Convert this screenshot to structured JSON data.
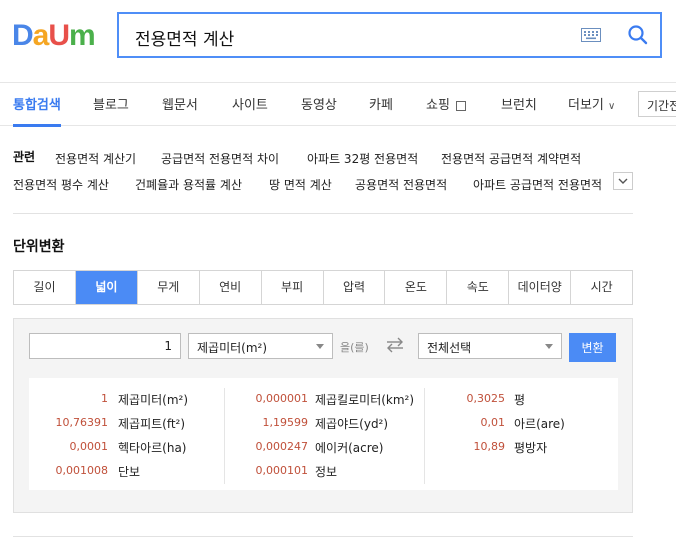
{
  "logo": {
    "letters": [
      "D",
      "a",
      "U",
      "m"
    ],
    "colors": [
      "#4a86e8",
      "#f5a623",
      "#e8504a",
      "#4bb04b"
    ]
  },
  "search": {
    "value": "전용면적 계산"
  },
  "nav": {
    "items": [
      "통합검색",
      "블로그",
      "웹문서",
      "사이트",
      "동영상",
      "카페",
      "쇼핑",
      "브런치",
      "더보기"
    ],
    "period_label": "기간전체"
  },
  "related": {
    "label": "관련",
    "row1": [
      "전용면적 계산기",
      "공급면적 전용면적 차이",
      "아파트 32평 전용면적",
      "전용면적 공급면적 계약면적"
    ],
    "row2": [
      "전용면적 평수 계산",
      "건폐율과 용적률 계산",
      "땅 면적 계산",
      "공용면적 전용면적",
      "아파트 공급면적 전용면적"
    ]
  },
  "converter": {
    "title": "단위변환",
    "tabs": [
      "길이",
      "넓이",
      "무게",
      "연비",
      "부피",
      "압력",
      "온도",
      "속도",
      "데이터양",
      "시간"
    ],
    "active_tab": "넓이",
    "input_value": "1",
    "from_unit": "제곱미터(m²)",
    "particle": "을(를)",
    "to_unit": "전체선택",
    "convert_label": "변환",
    "results": [
      [
        {
          "value": "1",
          "unit": "제곱미터(m²)"
        },
        {
          "value": "10,76391",
          "unit": "제곱피트(ft²)"
        },
        {
          "value": "0,0001",
          "unit": "헥타아르(ha)"
        },
        {
          "value": "0,001008",
          "unit": "단보"
        }
      ],
      [
        {
          "value": "0,000001",
          "unit": "제곱킬로미터(km²)"
        },
        {
          "value": "1,19599",
          "unit": "제곱야드(yd²)"
        },
        {
          "value": "0,000247",
          "unit": "에이커(acre)"
        },
        {
          "value": "0,000101",
          "unit": "정보"
        }
      ],
      [
        {
          "value": "0,3025",
          "unit": "평"
        },
        {
          "value": "0,01",
          "unit": "아르(are)"
        },
        {
          "value": "10,89",
          "unit": "평방자"
        }
      ]
    ]
  }
}
